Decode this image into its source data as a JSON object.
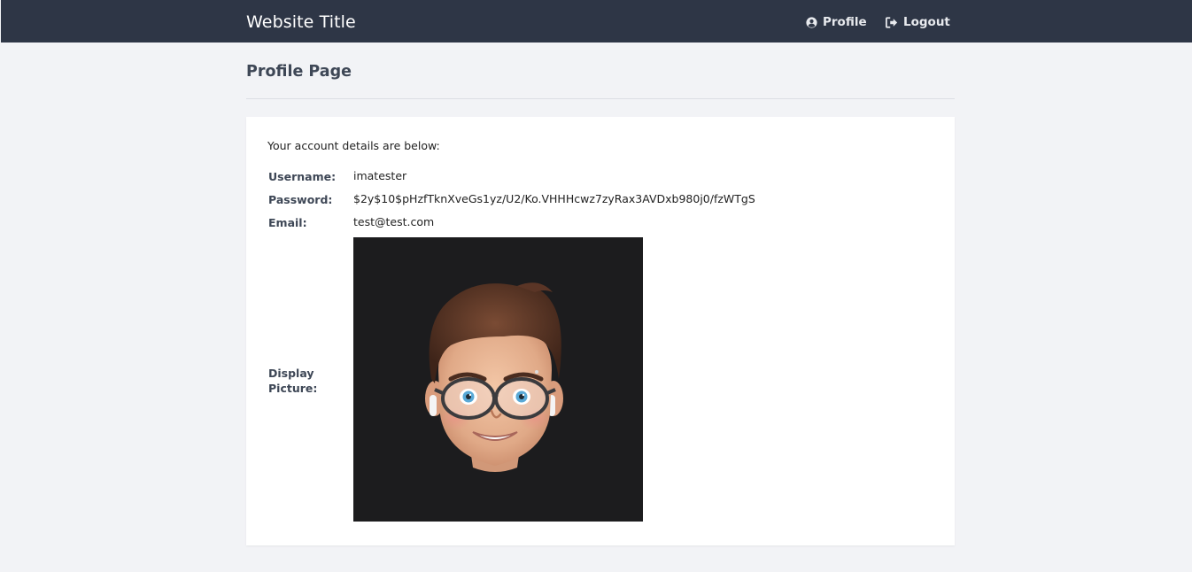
{
  "header": {
    "site_title": "Website Title",
    "nav": {
      "profile": {
        "label": "Profile",
        "icon": "user-circle-icon"
      },
      "logout": {
        "label": "Logout",
        "icon": "sign-out-icon"
      }
    }
  },
  "page": {
    "title": "Profile Page"
  },
  "account": {
    "intro": "Your account details are below:",
    "username_label": "Username:",
    "username": "imatester",
    "password_label": "Password:",
    "password": "$2y$10$pHzfTknXveGs1yz/U2/Ko.VHHHcwz7zyRax3AVDxb980j0/fzWTgS",
    "email_label": "Email:",
    "email": "test@test.com",
    "picture_label": "Display Picture:",
    "picture_icon": "memoji-avatar"
  },
  "colors": {
    "navbar": "#2e3646",
    "background": "#f2f3f6",
    "card": "#ffffff",
    "label": "#3e4756",
    "picture_background": "#1c1c1e"
  }
}
